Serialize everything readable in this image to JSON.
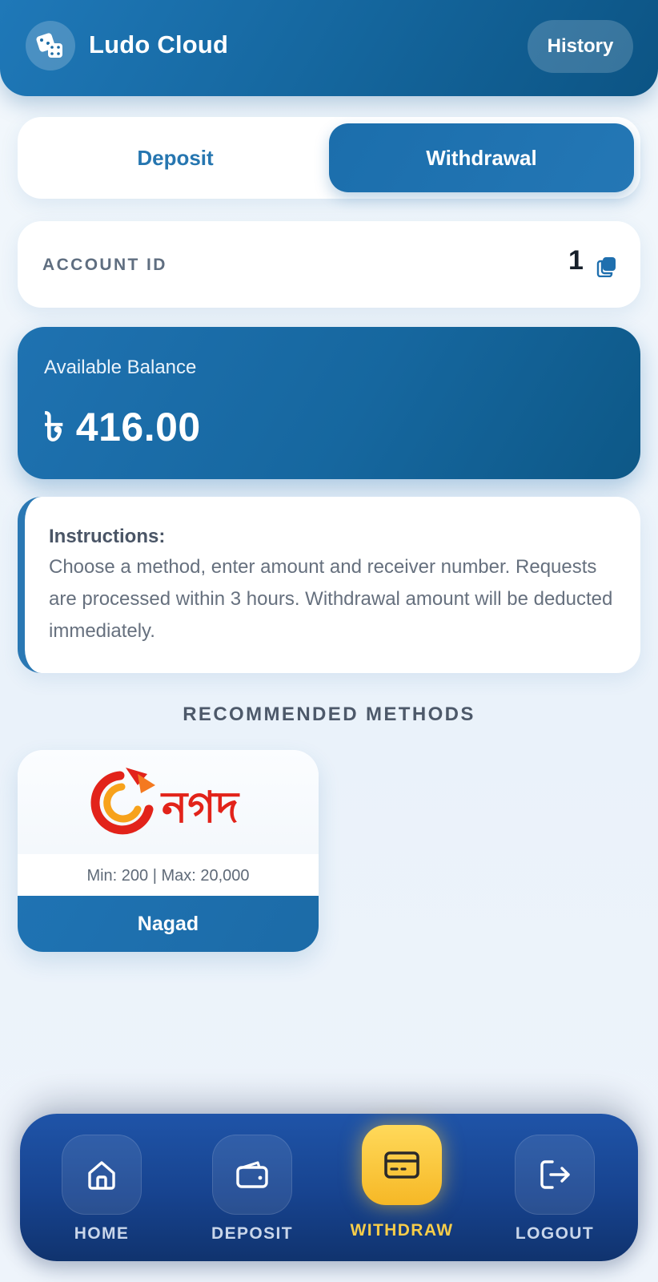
{
  "header": {
    "title": "Ludo Cloud",
    "history_label": "History",
    "brand_icon": "dice-icon"
  },
  "tabs": [
    {
      "label": "Deposit",
      "active": false
    },
    {
      "label": "Withdrawal",
      "active": true
    }
  ],
  "account": {
    "label": "ACCOUNT ID",
    "value": "1",
    "copy_icon": "copy-icon"
  },
  "balance": {
    "label": "Available Balance",
    "value": "৳ 416.00"
  },
  "instructions": {
    "title": "Instructions:",
    "body": "Choose a method, enter amount and receiver number. Requests are processed within 3 hours. Withdrawal amount will be deducted immediately."
  },
  "methods": {
    "section_title": "RECOMMENDED METHODS",
    "items": [
      {
        "logo_text": "নগদ",
        "limits": "Min: 200 | Max: 20,000",
        "name": "Nagad"
      }
    ]
  },
  "nav": [
    {
      "label": "HOME",
      "icon": "home-icon",
      "active": false
    },
    {
      "label": "DEPOSIT",
      "icon": "wallet-icon",
      "active": false
    },
    {
      "label": "WITHDRAW",
      "icon": "card-icon",
      "active": true
    },
    {
      "label": "LOGOUT",
      "icon": "logout-icon",
      "active": false
    }
  ],
  "colors": {
    "primary": "#1f72b1",
    "nav_bg": "#17438f",
    "active_nav": "#f7cd49",
    "nagad_red": "#e2231a",
    "nagad_orange": "#f47920"
  }
}
